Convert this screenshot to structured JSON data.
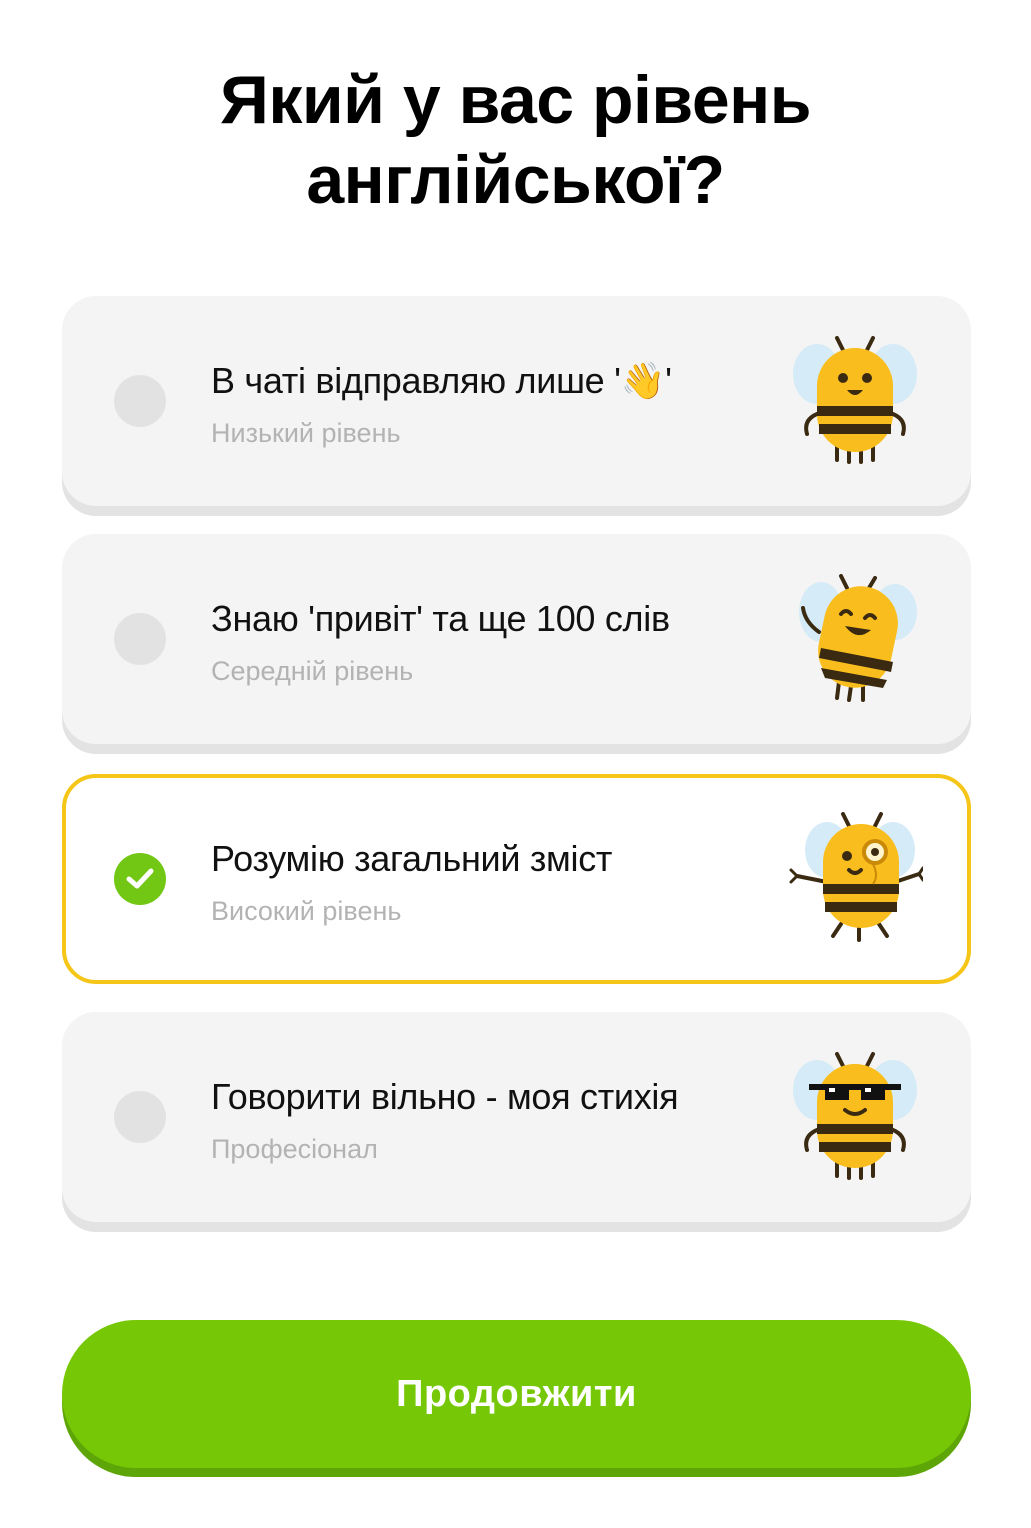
{
  "question": {
    "line1": "Який у вас рівень",
    "line2": "англійської?"
  },
  "options": [
    {
      "title": "В чаті відправляю лише '👋'",
      "subtitle": "Низький рівень",
      "selected": false,
      "mascot": "bee-smiling-icon"
    },
    {
      "title": "Знаю 'привіт' та ще 100 слів",
      "subtitle": "Середній рівень",
      "selected": false,
      "mascot": "bee-waving-icon"
    },
    {
      "title": "Розумію загальний зміст",
      "subtitle": "Високий рівень",
      "selected": true,
      "mascot": "bee-monocle-icon"
    },
    {
      "title": "Говорити вільно - моя стихія",
      "subtitle": "Професіонал",
      "selected": false,
      "mascot": "bee-sunglasses-icon"
    }
  ],
  "continue_label": "Продовжити",
  "colors": {
    "accent_green": "#76c807",
    "selected_border": "#f5c518",
    "card_bg": "#f4f4f4",
    "subtitle_gray": "#b3b3b3"
  }
}
